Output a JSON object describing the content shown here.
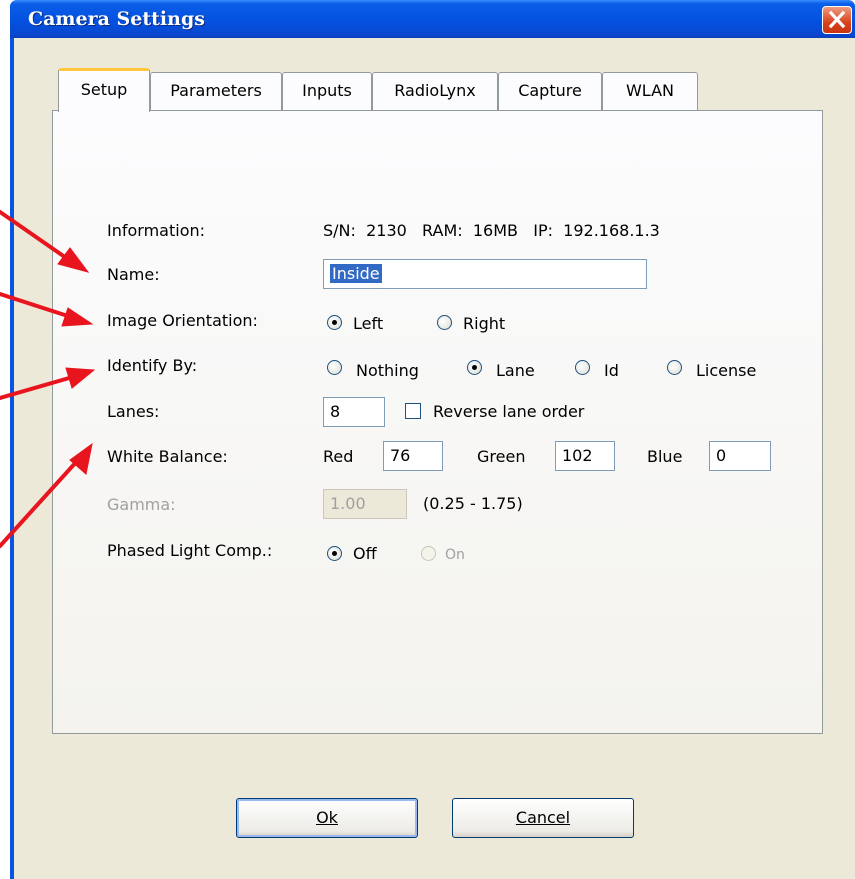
{
  "window": {
    "title": "Camera Settings"
  },
  "tabs": [
    {
      "label": "Setup",
      "active": true
    },
    {
      "label": "Parameters",
      "active": false
    },
    {
      "label": "Inputs",
      "active": false
    },
    {
      "label": "RadioLynx",
      "active": false
    },
    {
      "label": "Capture",
      "active": false
    },
    {
      "label": "WLAN",
      "active": false
    }
  ],
  "setup": {
    "information": {
      "label": "Information:",
      "value": "S/N:  2130   RAM:  16MB   IP:  192.168.1.3"
    },
    "name": {
      "label": "Name:",
      "value": "Inside"
    },
    "image_orientation": {
      "label": "Image Orientation:",
      "options": [
        "Left",
        "Right"
      ],
      "selected": "Left"
    },
    "identify_by": {
      "label": "Identify By:",
      "options": [
        "Nothing",
        "Lane",
        "Id",
        "License"
      ],
      "selected": "Lane"
    },
    "lanes": {
      "label": "Lanes:",
      "value": "8",
      "reverse_label": "Reverse lane order",
      "reverse_checked": false
    },
    "white_balance": {
      "label": "White Balance:",
      "red_label": "Red",
      "red": "76",
      "green_label": "Green",
      "green": "102",
      "blue_label": "Blue",
      "blue": "0"
    },
    "gamma": {
      "label": "Gamma:",
      "value": "1.00",
      "range": "(0.25 - 1.75)"
    },
    "phased_light": {
      "label": "Phased Light Comp.:",
      "options": [
        "Off",
        "On"
      ],
      "selected": "Off"
    }
  },
  "buttons": {
    "ok": "Ok",
    "cancel": "Cancel"
  },
  "colors": {
    "annotation_arrow": "#e8141e",
    "titlebar": "#0551e0",
    "tab_highlight": "#ffc83c"
  }
}
